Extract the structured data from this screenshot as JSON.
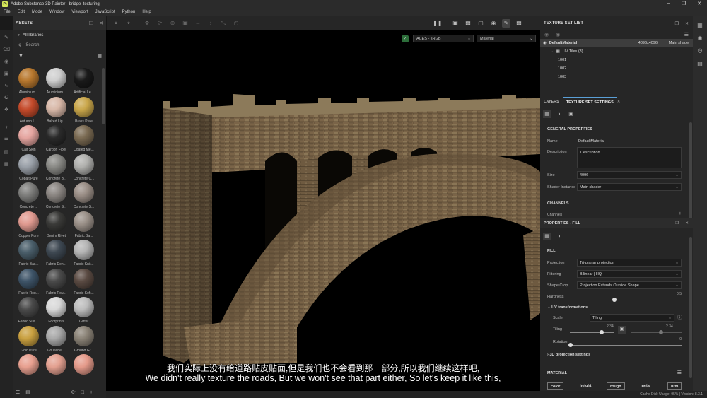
{
  "window": {
    "title": "Adobe Substance 3D Painter - bridge_texturing",
    "app_icon_text": "Pt"
  },
  "menu": [
    "File",
    "Edit",
    "Mode",
    "Window",
    "Viewport",
    "JavaScript",
    "Python",
    "Help"
  ],
  "assets": {
    "title": "ASSETS",
    "library": "All libraries",
    "search_placeholder": "Search",
    "items": [
      {
        "label": "Aluminium...",
        "color": "#b8782e"
      },
      {
        "label": "Aluminium...",
        "color": "#cfcfcf"
      },
      {
        "label": "Artificial Le...",
        "color": "#1a1a1a"
      },
      {
        "label": "Autumn L...",
        "color": "#c44a2a"
      },
      {
        "label": "Baked Lig...",
        "color": "#d8b8a8"
      },
      {
        "label": "Brass Pure",
        "color": "#c9a64a"
      },
      {
        "label": "Calf Skin",
        "color": "#e5a5a0"
      },
      {
        "label": "Carbon Fiber",
        "color": "#2a2a2a"
      },
      {
        "label": "Coated Me...",
        "color": "#7a6a52"
      },
      {
        "label": "Cobalt Pure",
        "color": "#9aa0a8"
      },
      {
        "label": "Concrete B...",
        "color": "#8a8a86"
      },
      {
        "label": "Concrete C...",
        "color": "#b0b0ad"
      },
      {
        "label": "Concrete ...",
        "color": "#7e7e7c"
      },
      {
        "label": "Concrete S...",
        "color": "#8b8682"
      },
      {
        "label": "Concrete S...",
        "color": "#9a8e86"
      },
      {
        "label": "Copper Pure",
        "color": "#e09a90"
      },
      {
        "label": "Denim Rivet",
        "color": "#3a3a38"
      },
      {
        "label": "Fabric Ba...",
        "color": "#9a9088"
      },
      {
        "label": "Fabric Bas...",
        "color": "#4a5e6a"
      },
      {
        "label": "Fabric Den...",
        "color": "#3e4852"
      },
      {
        "label": "Fabric Knit...",
        "color": "#b4b4b4"
      },
      {
        "label": "Fabric Rou...",
        "color": "#3e5468"
      },
      {
        "label": "Fabric Rou...",
        "color": "#4a4a4a"
      },
      {
        "label": "Fabric Soft...",
        "color": "#5a4a42"
      },
      {
        "label": "Fabric Suit ...",
        "color": "#4a4a4a"
      },
      {
        "label": "Footprints",
        "color": "#d8d8d8"
      },
      {
        "label": "Glitter",
        "color": "#bcbcbc"
      },
      {
        "label": "Gold Pure",
        "color": "#c9a040"
      },
      {
        "label": "Gouache ...",
        "color": "#a8a8a8"
      },
      {
        "label": "Ground Gr...",
        "color": "#8a8276"
      },
      {
        "label": "",
        "color": "#e8a090"
      },
      {
        "label": "",
        "color": "#e3a090"
      },
      {
        "label": "",
        "color": "#e49a8a"
      }
    ]
  },
  "viewport": {
    "colorspace": "ACES - sRGB",
    "mode": "Material"
  },
  "subtitles": {
    "zh": "我们实际上没有给道路贴皮贴面,但是我们也不会看到那一部分,所以我们继续这样吧,",
    "en": "We didn't really texture the roads, But we won't see that part either, So let's keep it like this,"
  },
  "status": {
    "text": "Cache Disk Usage:   95% | Version: 8.3.1"
  },
  "texture_set_list": {
    "title": "TEXTURE SET LIST",
    "material": {
      "name": "DefaultMaterial",
      "size": "4096x4096",
      "shader": "Main shader"
    },
    "uv_tiles_label": "UV Tiles (3)",
    "tiles": [
      "1001",
      "1002",
      "1003"
    ]
  },
  "tabs": {
    "layers": "LAYERS",
    "settings": "TEXTURE SET SETTINGS"
  },
  "general": {
    "title": "GENERAL PROPERTIES",
    "name_label": "Name",
    "name_value": "DefaultMaterial",
    "description_label": "Description",
    "description_value": "Description",
    "size_label": "Size",
    "size_value": "4096",
    "shader_label": "Shader Instance",
    "shader_value": "Main shader",
    "channels_title": "CHANNELS",
    "channels_label": "Channels"
  },
  "fill": {
    "title": "PROPERTIES - FILL",
    "section": "FILL",
    "projection_label": "Projection",
    "projection_value": "Tri-planar projection",
    "filtering_label": "Filtering",
    "filtering_value": "Bilinear | HQ",
    "shapecrop_label": "Shape Crop",
    "shapecrop_value": "Projection Extends Outside Shape",
    "hardness_label": "Hardness",
    "hardness_value": "0.5",
    "hardness_level": 0.5,
    "uv_title": "UV transformations",
    "scale_label": "Scale",
    "scale_value": "Tiling",
    "tiling_label": "Tiling",
    "tiling_value": "2.34",
    "tiling_value2": "2.34",
    "rotation_label": "Rotation",
    "rotation_value": "0",
    "proj3d_title": "3D projection settings",
    "material_title": "MATERIAL",
    "chips": [
      "color",
      "height",
      "rough",
      "metal",
      "nrm"
    ]
  }
}
